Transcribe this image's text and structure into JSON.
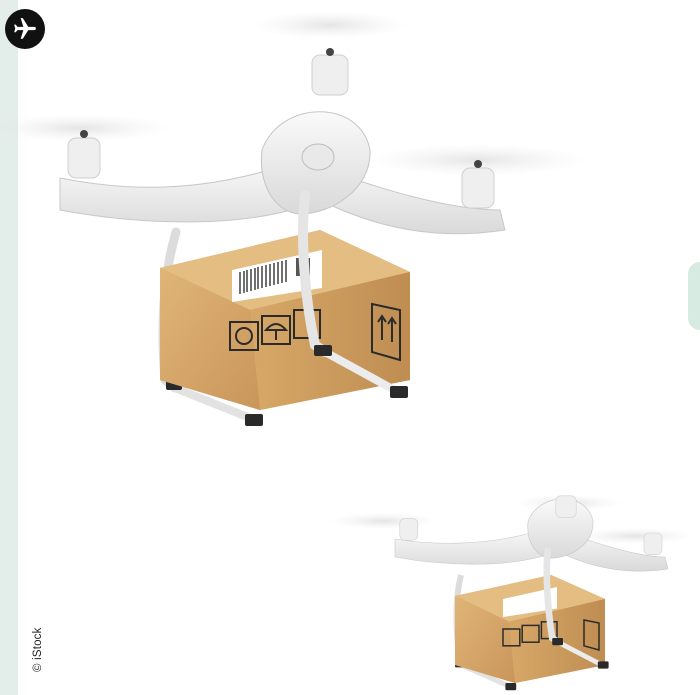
{
  "credit": {
    "text": "© iStock"
  },
  "icons": {
    "badge": "airplane-icon"
  },
  "colors": {
    "strip": "#e3ede9",
    "tab": "#d7ebe2",
    "badge": "#111111",
    "drone_body": "#f2f2f2",
    "box": "#d6a866"
  }
}
